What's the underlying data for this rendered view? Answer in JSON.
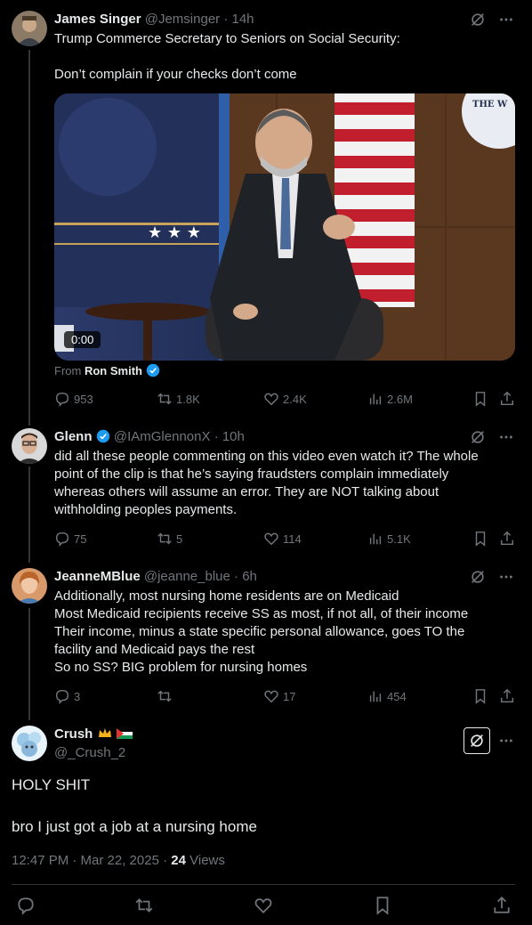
{
  "tweets": [
    {
      "name": "James Singer",
      "handle": "@Jemsinger",
      "time": "14h",
      "lines": [
        "Trump Commerce Secretary to Seniors on Social Security:",
        "",
        "Don’t complain if your checks don’t come"
      ],
      "video_time": "0:00",
      "from_prefix": "From",
      "from_name": "Ron Smith",
      "replies": "953",
      "reposts": "1.8K",
      "likes": "2.4K",
      "views": "2.6M"
    },
    {
      "name": "Glenn",
      "handle": "@IAmGlennonX",
      "time": "10h",
      "lines": [
        "did all these people commenting on this video even watch it? The whole",
        "point of the clip is that he’s saying fraudsters complain immediately",
        "whereas others will assume an error. They are NOT talking about",
        "withholding peoples payments."
      ],
      "replies": "75",
      "reposts": "5",
      "likes": "114",
      "views": "5.1K"
    },
    {
      "name": "JeanneMBlue",
      "handle": "@jeanne_blue",
      "time": "6h",
      "lines": [
        "Additionally, most nursing home residents are on Medicaid",
        "Most Medicaid recipients receive SS as most, if not all, of their income",
        "Their income, minus a state specific personal allowance, goes TO the",
        "facility and Medicaid pays the rest",
        "So no SS? BIG problem for nursing homes"
      ],
      "replies": "3",
      "reposts": "",
      "likes": "17",
      "views": "454"
    }
  ],
  "main": {
    "name": "Crush",
    "handle": "@_Crush_2",
    "line1": "HOLY SHIT",
    "line2": "bro I just got a job at a nursing home",
    "timestamp": "12:47 PM · Mar 22, 2025 ·",
    "views_count": "24",
    "views_label": "Views"
  },
  "icons": {
    "grok": "grok-icon",
    "more": "more-icon",
    "reply": "reply-icon",
    "repost": "repost-icon",
    "like": "like-icon",
    "views": "views-icon",
    "bookmark": "bookmark-icon",
    "share": "share-icon",
    "verified": "verified-badge-icon"
  },
  "colors": {
    "background": "#000000",
    "text": "#e7e9ea",
    "secondary": "#71767b",
    "verified": "#1d9bf0",
    "divider": "#2f3336"
  }
}
